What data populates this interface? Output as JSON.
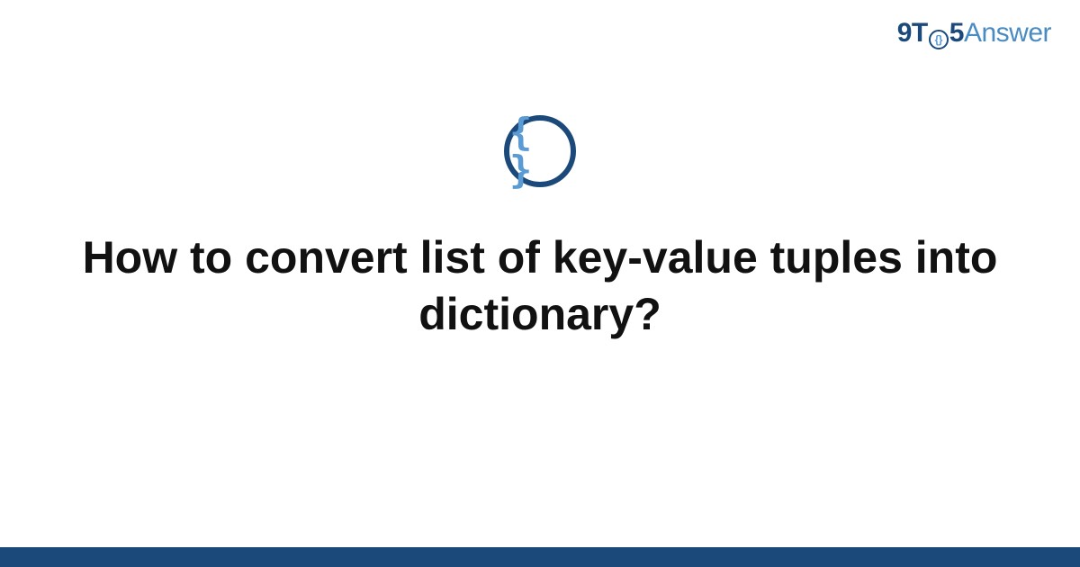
{
  "brand": {
    "part1": "9T",
    "zero_inner": "{}",
    "part2": "5",
    "part3": "Answer"
  },
  "icon": {
    "braces": "{ }"
  },
  "title": "How to convert list of key-value tuples into dictionary?",
  "colors": {
    "dark_blue": "#1b4a7a",
    "light_blue": "#5a9bd4",
    "brand_light": "#4a8bc2"
  }
}
